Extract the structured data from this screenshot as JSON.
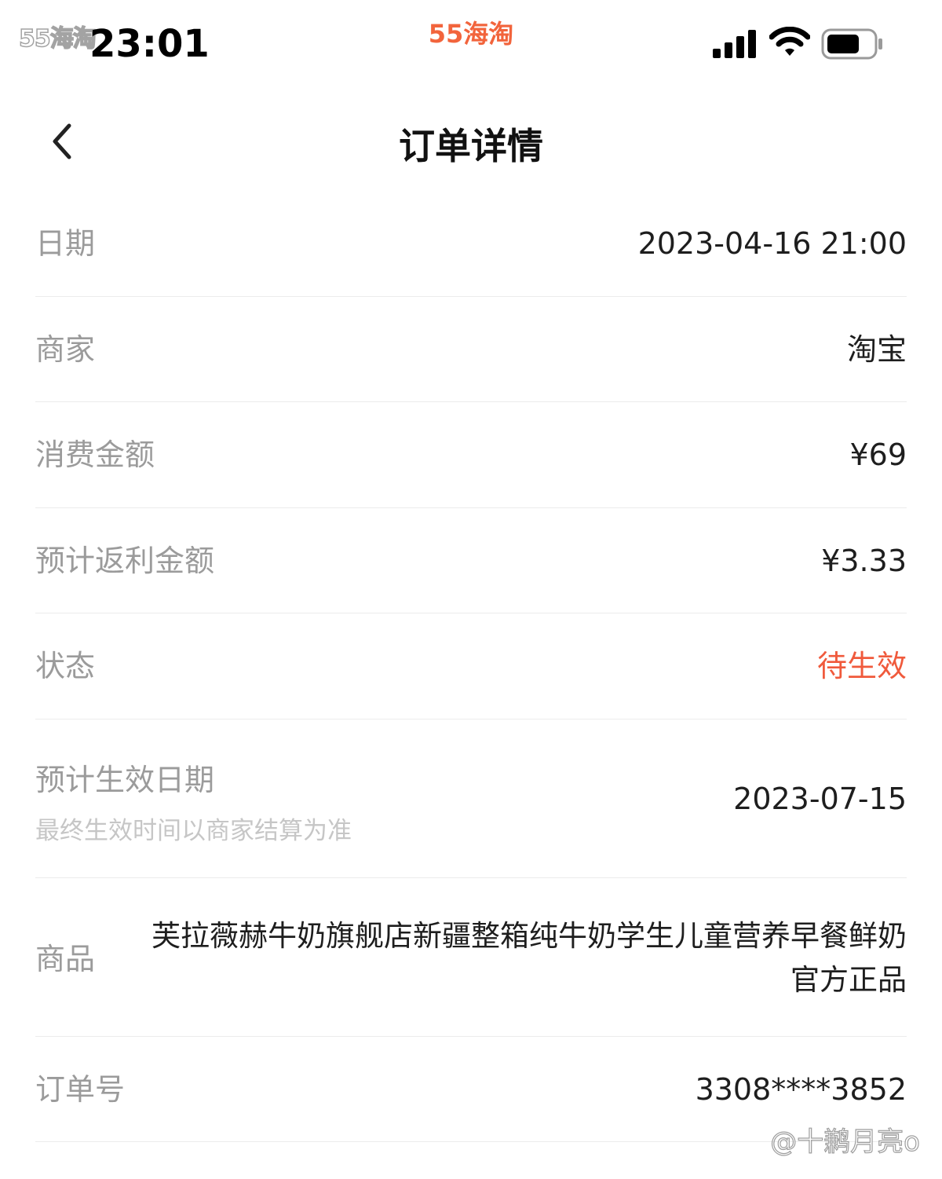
{
  "status_bar": {
    "time": "23:01",
    "watermark_left": "55海淘",
    "watermark_center": "55海淘",
    "signal": "cellular-signal-icon",
    "wifi": "wifi-icon",
    "battery": "battery-icon"
  },
  "nav": {
    "back_icon": "chevron-left-icon",
    "title": "订单详情"
  },
  "details": {
    "date": {
      "label": "日期",
      "value": "2023-04-16 21:00"
    },
    "merchant": {
      "label": "商家",
      "value": "淘宝"
    },
    "amount": {
      "label": "消费金额",
      "value": "¥69"
    },
    "rebate": {
      "label": "预计返利金额",
      "value": "¥3.33"
    },
    "status": {
      "label": "状态",
      "value": "待生效",
      "color": "#f05a3c"
    },
    "effective_date": {
      "label": "预计生效日期",
      "note": "最终生效时间以商家结算为准",
      "value": "2023-07-15"
    },
    "product": {
      "label": "商品",
      "value": "芙拉薇赫牛奶旗舰店新疆整箱纯牛奶学生儿童营养早餐鲜奶官方正品"
    },
    "order_no": {
      "label": "订单号",
      "value": "3308****3852"
    }
  },
  "watermark_bottom": "@十鹣月亮o",
  "colors": {
    "accent": "#f2643c",
    "label": "#9b9b9b",
    "divider": "#ececec"
  }
}
